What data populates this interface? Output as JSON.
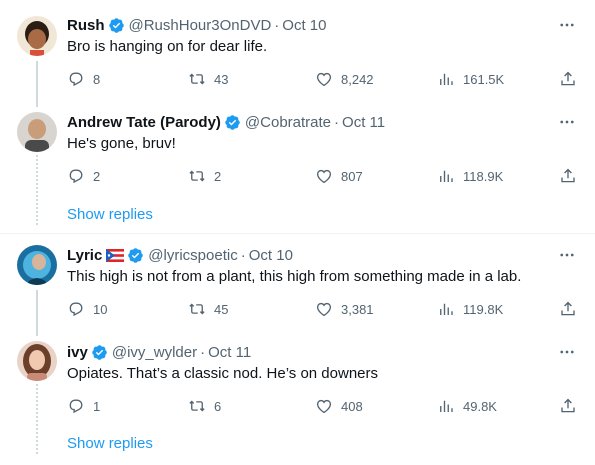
{
  "colors": {
    "accent": "#1d9bf0",
    "muted": "#536471",
    "text": "#0f1419"
  },
  "threads": [
    {
      "tweets": [
        {
          "name": "Rush",
          "handle": "@RushHour3OnDVD",
          "date": "Oct 10",
          "text": "Bro is hanging on for dear life.",
          "replies": "8",
          "retweets": "43",
          "likes": "8,242",
          "views": "161.5K"
        },
        {
          "name": "Andrew Tate (Parody)",
          "handle": "@Cobratrate",
          "date": "Oct 11",
          "text": "He's gone, bruv!",
          "replies": "2",
          "retweets": "2",
          "likes": "807",
          "views": "118.9K"
        }
      ],
      "show_replies": "Show replies"
    },
    {
      "tweets": [
        {
          "name": "Lyric",
          "handle": "@lyricspoetic",
          "date": "Oct 10",
          "text": "This high is not from a plant, this high from something made in a lab.",
          "replies": "10",
          "retweets": "45",
          "likes": "3,381",
          "views": "119.8K"
        },
        {
          "name": "ivy",
          "handle": "@ivy_wylder",
          "date": "Oct 11",
          "text": "Opiates. That’s a classic nod. He’s on downers",
          "replies": "1",
          "retweets": "6",
          "likes": "408",
          "views": "49.8K"
        }
      ],
      "show_replies": "Show replies"
    }
  ],
  "separator": "·"
}
